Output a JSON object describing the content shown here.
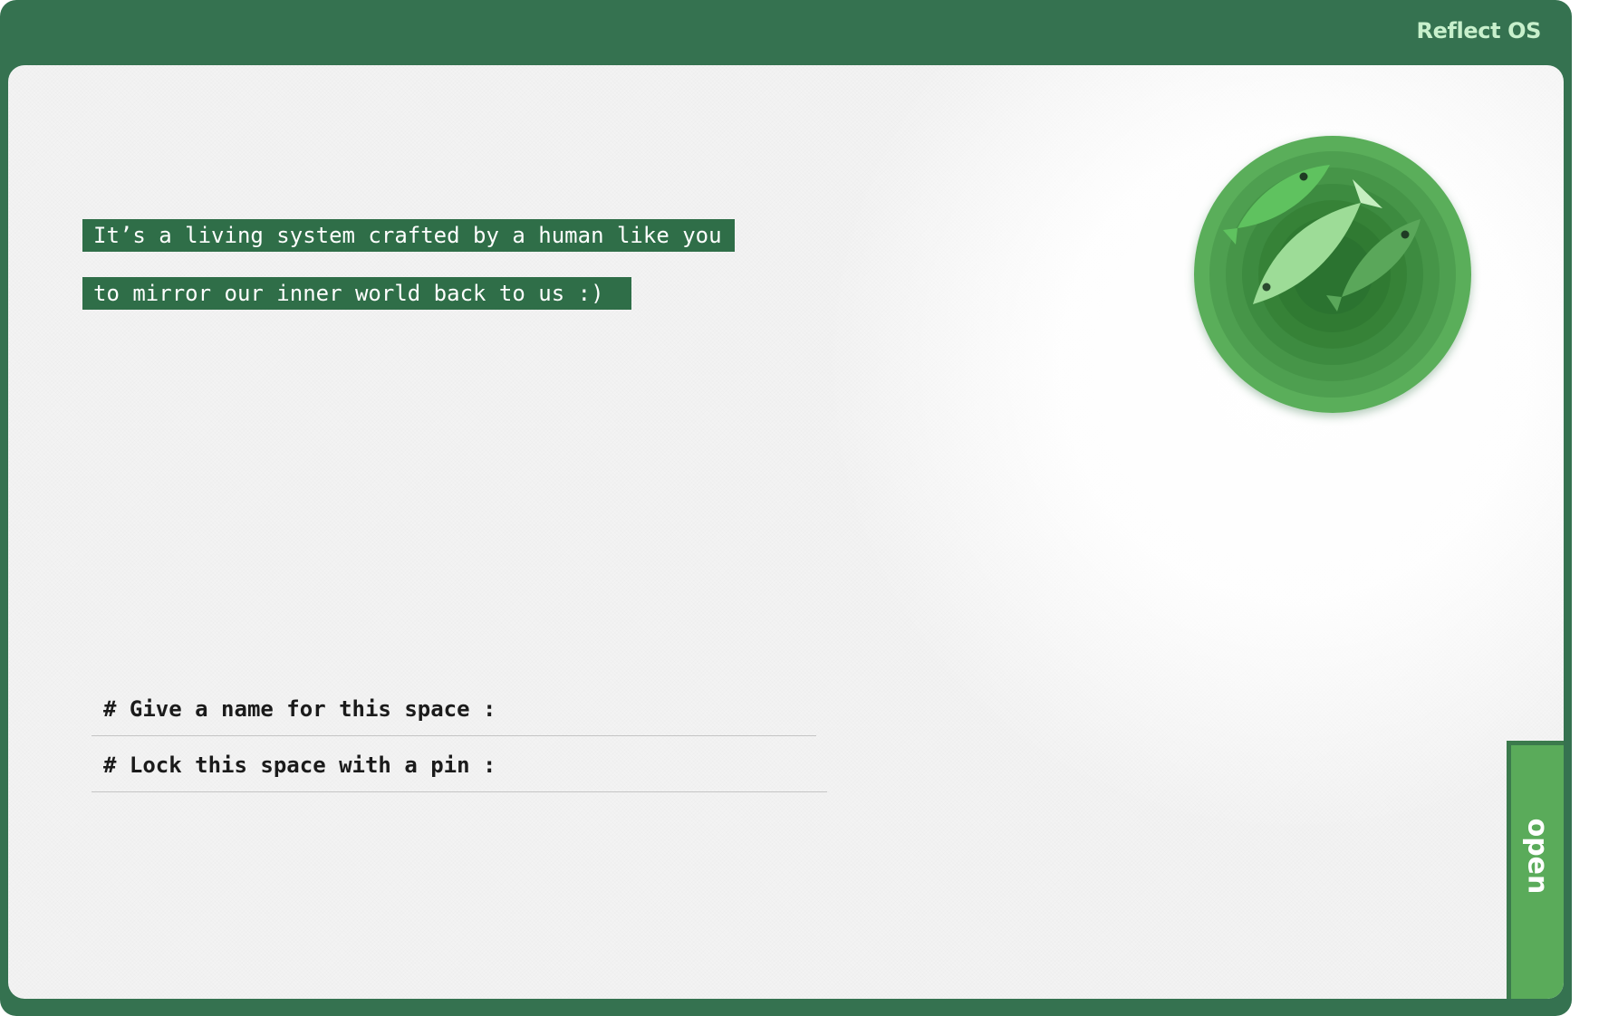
{
  "app": {
    "brand": "Reflect OS"
  },
  "intro": {
    "line1": "It’s a living system crafted by a human like you",
    "line2": "to mirror our inner world back to us :)"
  },
  "form": {
    "name_label": "# Give a name for this space :",
    "name_value": "",
    "pin_label": "# Lock this space with a pin :",
    "pin_value": ""
  },
  "logo": {
    "icon": "pisces-fish-icon"
  },
  "actions": {
    "open_label": "open"
  },
  "colors": {
    "frame": "#357250",
    "brand_text": "#c8f0cc",
    "intro_highlight": "#2f6e48",
    "tab": "#5aab5a",
    "medallion_outer": "#5aae5a",
    "medallion_inner": "#2f7a33"
  }
}
